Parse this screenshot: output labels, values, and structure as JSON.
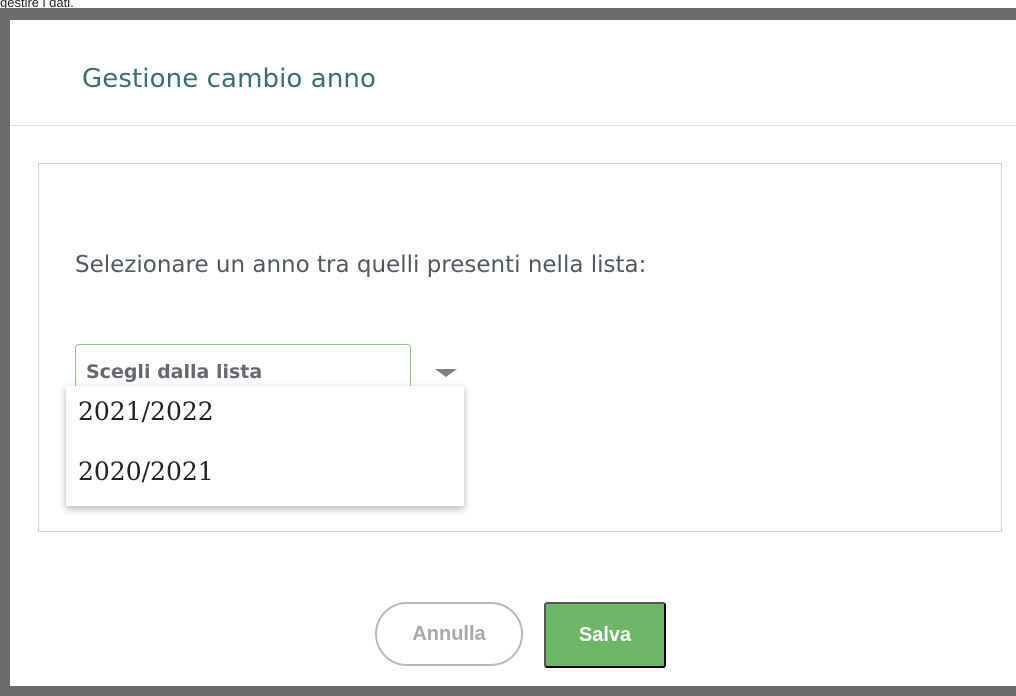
{
  "background": {
    "partial_text": "gestire i dati."
  },
  "dialog": {
    "title": "Gestione cambio anno",
    "prompt": "Selezionare un anno tra quelli presenti nella lista:",
    "select": {
      "placeholder": "Scegli dalla lista",
      "options": [
        "2021/2022",
        "2020/2021"
      ]
    },
    "buttons": {
      "cancel_label": "Annulla",
      "save_label": "Salva"
    }
  },
  "colors": {
    "title": "#3b6f73",
    "select_border": "#8fc58a",
    "save_button": "#6cb665",
    "overlay_frame": "#6b6b6b"
  },
  "icons": {
    "dropdown_caret": "chevron-down-icon"
  }
}
